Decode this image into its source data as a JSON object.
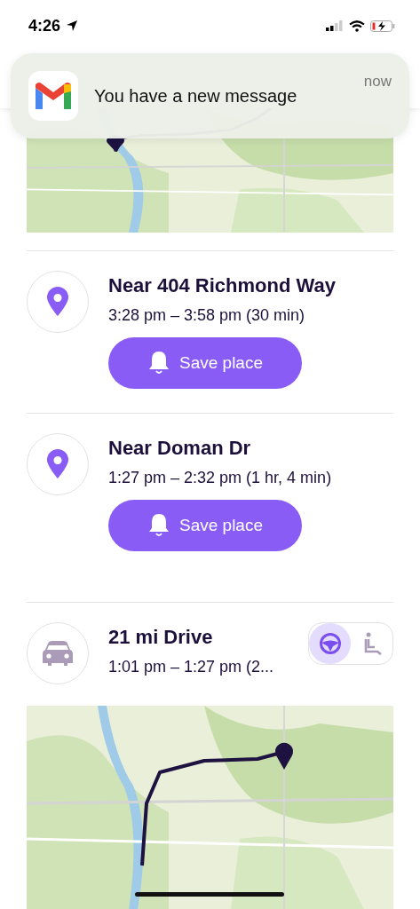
{
  "status_bar": {
    "time": "4:26"
  },
  "notification": {
    "message": "You have a new message",
    "time": "now"
  },
  "stops": [
    {
      "kind": "place",
      "title": "Near 404 Richmond Way",
      "times": "3:28 pm – 3:58 pm (30 min)",
      "button": "Save place"
    },
    {
      "kind": "place",
      "title": "Near Doman Dr",
      "times": "1:27 pm – 2:32 pm (1 hr, 4 min)",
      "button": "Save place"
    },
    {
      "kind": "drive",
      "title": "21 mi Drive",
      "times": "1:01 pm – 1:27 pm (2...",
      "modes": [
        {
          "kind": "driver",
          "selected": true
        },
        {
          "kind": "passenger",
          "selected": false
        }
      ]
    }
  ]
}
